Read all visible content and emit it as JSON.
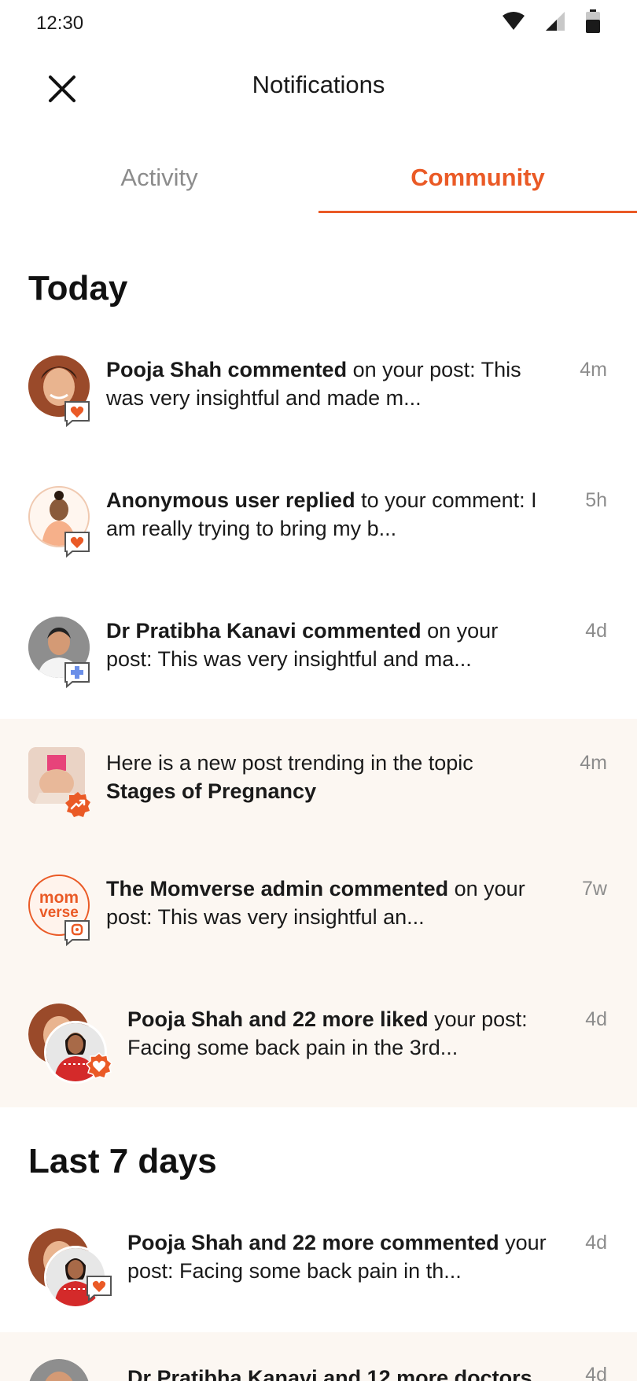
{
  "status_bar": {
    "time": "12:30"
  },
  "header": {
    "title": "Notifications"
  },
  "tabs": [
    {
      "label": "Activity",
      "active": false
    },
    {
      "label": "Community",
      "active": true
    }
  ],
  "colors": {
    "accent": "#ea5a26",
    "highlight_bg": "#fcf7f2",
    "muted_text": "#8c8c8c"
  },
  "sections": [
    {
      "title": "Today"
    },
    {
      "title": "Last 7 days"
    }
  ],
  "notifications": [
    {
      "actor": "Pooja Shah commented",
      "rest": " on your post: This was very insightful and made m...",
      "time": "4m",
      "badge": "heart-comment-icon"
    },
    {
      "actor": "Anonymous user replied",
      "rest": " to your comment: I am really trying to bring my b...",
      "time": "5h",
      "badge": "heart-reply-icon"
    },
    {
      "actor": "Dr Pratibha Kanavi commented",
      "rest": " on your post: This was very insightful and ma...",
      "time": "4d",
      "badge": "doctor-plus-icon"
    },
    {
      "lead": "Here is a new post trending in the topic ",
      "topic": "Stages of Pregnancy",
      "time": "4m",
      "badge": "trending-icon"
    },
    {
      "actor": "The Momverse admin commented",
      "rest": " on your post: This was very insightful an...",
      "time": "7w",
      "badge": "momverse-comment-icon",
      "logo_top": "mom",
      "logo_bottom": "verse"
    },
    {
      "actor": "Pooja Shah and 22 more liked",
      "rest": " your post: Facing some back pain in the 3rd...",
      "time": "4d",
      "badge": "heart-icon"
    },
    {
      "actor": "Pooja Shah and 22 more commented",
      "rest": " your post: Facing some back pain in th...",
      "time": "4d",
      "badge": "heart-comment-icon"
    },
    {
      "actor": "Dr Pratibha Kanavi and 12 more doctors",
      "rest": "",
      "time": "4d",
      "badge": "doctor-plus-icon"
    }
  ]
}
